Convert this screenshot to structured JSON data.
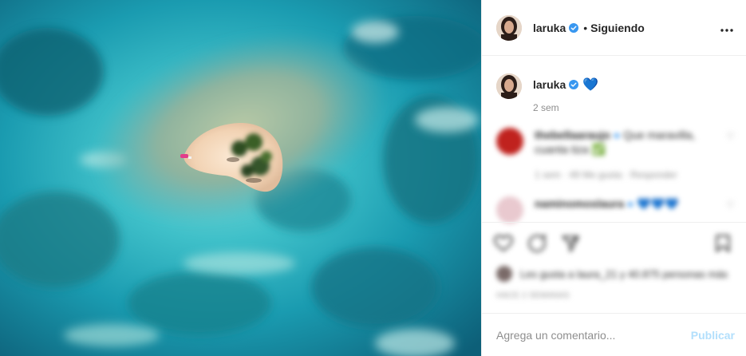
{
  "post": {
    "photo_alt": "",
    "header": {
      "username": "laruka",
      "separator": "•",
      "follow_status": "Siguiendo",
      "more_icon": "more-horizontal-icon"
    },
    "caption": {
      "username": "laruka",
      "emoji": "💙",
      "time": "2 sem"
    },
    "comments": [
      {
        "username": "thebellaaraujo",
        "text": "Que maravilla, cuanta tiza ✅",
        "meta": "1 sem   · 49 Me gusta   · Responder",
        "avatar_color": "#c0221e"
      },
      {
        "username": "naminomoslaura",
        "text": "💙💙💙",
        "meta": "",
        "avatar_color": "#e9c9cf"
      }
    ],
    "actions": {
      "like_icon": "heart-outline-icon",
      "comment_icon": "comment-icon",
      "share_icon": "share-icon",
      "save_icon": "bookmark-icon",
      "likes_text": "Les gusta a laura_21 y 40.875 personas más",
      "date": "HACE 2 SEMANAS"
    },
    "comment_input": {
      "placeholder": "Agrega un comentario...",
      "publish_label": "Publicar"
    },
    "colors": {
      "verified_blue": "#3897f0",
      "heart_blue": "#2d8fe8",
      "publish_disabled": "#b2dffc"
    }
  }
}
